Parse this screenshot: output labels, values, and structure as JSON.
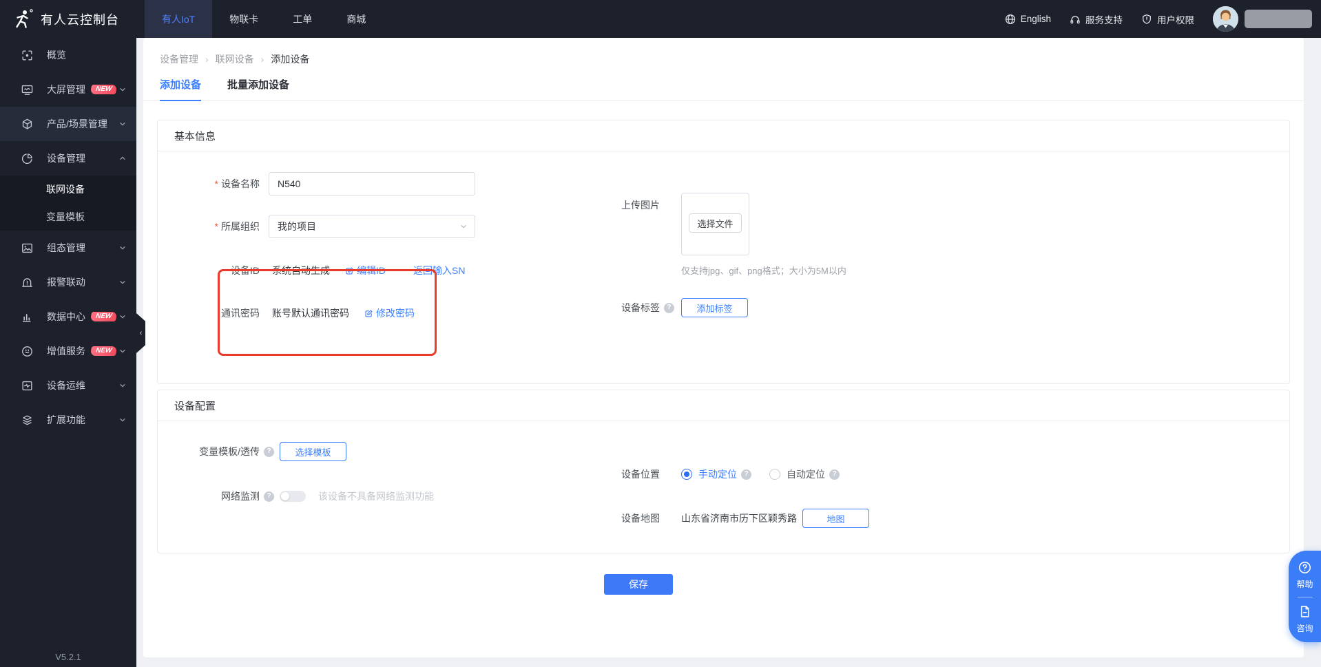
{
  "topbar": {
    "logo_text": "有人云控制台",
    "tabs": [
      {
        "label": "有人IoT",
        "active": true
      },
      {
        "label": "物联卡",
        "active": false
      },
      {
        "label": "工单",
        "active": false
      },
      {
        "label": "商城",
        "active": false
      }
    ],
    "right": {
      "language": "English",
      "support": "服务支持",
      "permissions": "用户权限"
    }
  },
  "sidebar": {
    "badge": "NEW",
    "items": [
      {
        "icon": "overview-icon",
        "label": "概览"
      },
      {
        "icon": "screen-icon",
        "label": "大屏管理",
        "badge": true
      },
      {
        "icon": "cube-icon",
        "label": "产品/场景管理"
      },
      {
        "icon": "pie-icon",
        "label": "设备管理",
        "expanded": true,
        "children": [
          {
            "label": "联网设备",
            "active": true
          },
          {
            "label": "变量模板",
            "active": false
          }
        ]
      },
      {
        "icon": "image-icon",
        "label": "组态管理"
      },
      {
        "icon": "alarm-icon",
        "label": "报警联动"
      },
      {
        "icon": "bar-chart-icon",
        "label": "数据中心",
        "badge": true
      },
      {
        "icon": "value-added-icon",
        "label": "增值服务",
        "badge": true
      },
      {
        "icon": "ops-monitor-icon",
        "label": "设备运维"
      },
      {
        "icon": "layers-icon",
        "label": "扩展功能"
      }
    ],
    "version": "V5.2.1"
  },
  "breadcrumb": {
    "items": [
      "设备管理",
      "联网设备",
      "添加设备"
    ]
  },
  "page_tabs": [
    {
      "label": "添加设备",
      "active": true
    },
    {
      "label": "批量添加设备",
      "active": false
    }
  ],
  "basic_info": {
    "title": "基本信息",
    "device_name": {
      "label": "设备名称",
      "value": "N540",
      "required": true
    },
    "organization": {
      "label": "所属组织",
      "value": "我的项目",
      "required": true
    },
    "device_id": {
      "label": "设备ID",
      "value": "系统自动生成",
      "edit_link": "编辑ID",
      "sn_link": "返回输入SN"
    },
    "comm_password": {
      "label": "通讯密码",
      "value": "账号默认通讯密码",
      "edit_link": "修改密码"
    },
    "upload": {
      "label": "上传图片",
      "button": "选择文件",
      "hint": "仅支持jpg、gif、png格式；大小为5M以内"
    },
    "tags": {
      "label": "设备标签",
      "button": "添加标签"
    }
  },
  "device_config": {
    "title": "设备配置",
    "template": {
      "label": "变量模板/透传",
      "button": "选择模板"
    },
    "network": {
      "label": "网络监测",
      "toggle_on": false,
      "note": "该设备不具备网络监测功能"
    },
    "location": {
      "label": "设备位置",
      "options": [
        {
          "label": "手动定位",
          "selected": true
        },
        {
          "label": "自动定位",
          "selected": false
        }
      ]
    },
    "map": {
      "label": "设备地图",
      "address": "山东省济南市历下区颖秀路",
      "button": "地图"
    }
  },
  "save_label": "保存",
  "float_widget": {
    "help": "帮助",
    "consult": "咨询"
  },
  "colors": {
    "topbar_bg": "#1d212c",
    "accent_blue": "#3d7fff",
    "save_blue": "#3e79f7",
    "annotation_red": "#e93a2e",
    "badge_gradient_start": "#ff7183",
    "badge_gradient_end": "#f34a5e",
    "content_bg": "#eef0f4"
  }
}
